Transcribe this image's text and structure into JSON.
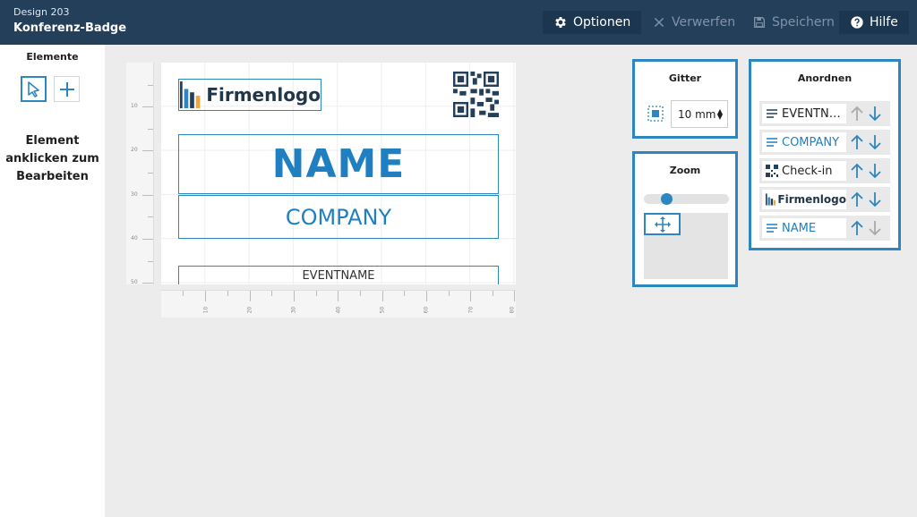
{
  "header": {
    "subtitle": "Design 203",
    "title": "Konferenz-Badge",
    "buttons": [
      {
        "label": "Optionen",
        "icon": "gear-icon",
        "state": "active"
      },
      {
        "label": "Verwerfen",
        "icon": "close-icon",
        "state": "disabled"
      },
      {
        "label": "Speichern",
        "icon": "save-icon",
        "state": "disabled"
      },
      {
        "label": "Hilfe",
        "icon": "help-icon",
        "state": "active"
      }
    ]
  },
  "sidebar": {
    "title": "Elemente",
    "tools": [
      {
        "icon": "pointer-icon",
        "selected": true
      },
      {
        "icon": "plus-icon",
        "selected": false
      }
    ],
    "hint": "Element anklicken zum Bearbeiten"
  },
  "canvas": {
    "ruler_v_labels": [
      "10",
      "20",
      "30",
      "40",
      "50"
    ],
    "ruler_h_labels": [
      "10",
      "20",
      "30",
      "40",
      "50",
      "60",
      "70",
      "80"
    ],
    "logo_text": "Firmenlogo",
    "name_text": "NAME",
    "company_text": "COMPANY",
    "event_text": "EVENTNAME"
  },
  "gitter": {
    "title": "Gitter",
    "value": "10 mm"
  },
  "zoom": {
    "title": "Zoom",
    "level": 0.2
  },
  "anordnen": {
    "title": "Anordnen",
    "items": [
      {
        "label": "EVENTN…",
        "icon": "text-lines-icon",
        "up_enabled": false,
        "down_enabled": true,
        "blue": false
      },
      {
        "label": "COMPANY",
        "icon": "text-lines-icon",
        "up_enabled": true,
        "down_enabled": true,
        "blue": true
      },
      {
        "label": "Check-in",
        "icon": "qr-code-icon",
        "up_enabled": true,
        "down_enabled": true,
        "blue": false
      },
      {
        "label": "Firmenlogo",
        "icon": "logo-icon",
        "up_enabled": true,
        "down_enabled": true,
        "blue": false
      },
      {
        "label": "NAME",
        "icon": "text-lines-icon",
        "up_enabled": true,
        "down_enabled": false,
        "blue": true
      }
    ]
  },
  "colors": {
    "header": "#243f5a",
    "accent": "#2e86c1",
    "text_blue": "#1f7fc0"
  }
}
